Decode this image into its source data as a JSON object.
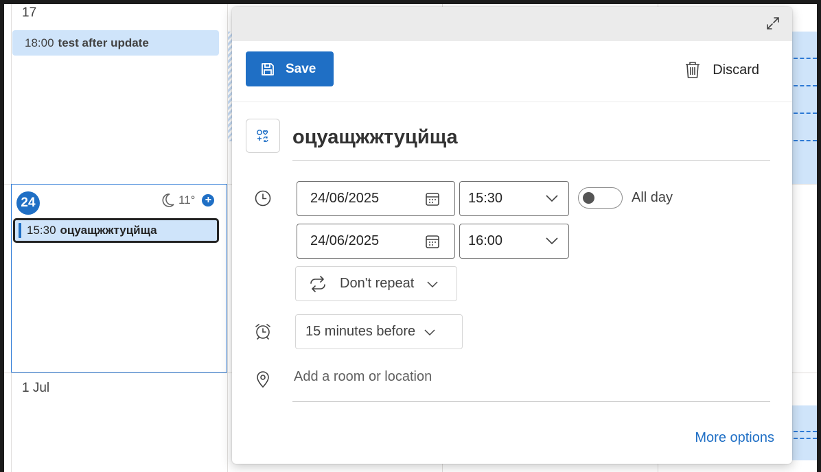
{
  "calendar": {
    "day_17": "17",
    "event_17": {
      "time": "18:00",
      "name": "test after update"
    },
    "day_24": "24",
    "weather": {
      "icon": "moon-icon",
      "temp": "11°"
    },
    "event_24": {
      "time": "15:30",
      "name": "оцуащжжтуцйща"
    },
    "day_1jul": "1 Jul"
  },
  "toolbar": {
    "save_label": "Save",
    "discard_label": "Discard"
  },
  "event": {
    "title": "оцуащжжтуцйща",
    "start_date": "24/06/2025",
    "start_time": "15:30",
    "end_date": "24/06/2025",
    "end_time": "16:00",
    "all_day_label": "All day",
    "all_day": false,
    "repeat": "Don't repeat",
    "reminder": "15 minutes before",
    "location_placeholder": "Add a room or location"
  },
  "links": {
    "more_options": "More options"
  },
  "colors": {
    "accent": "#1f6fc5",
    "event_bg": "#cfe4fa"
  }
}
